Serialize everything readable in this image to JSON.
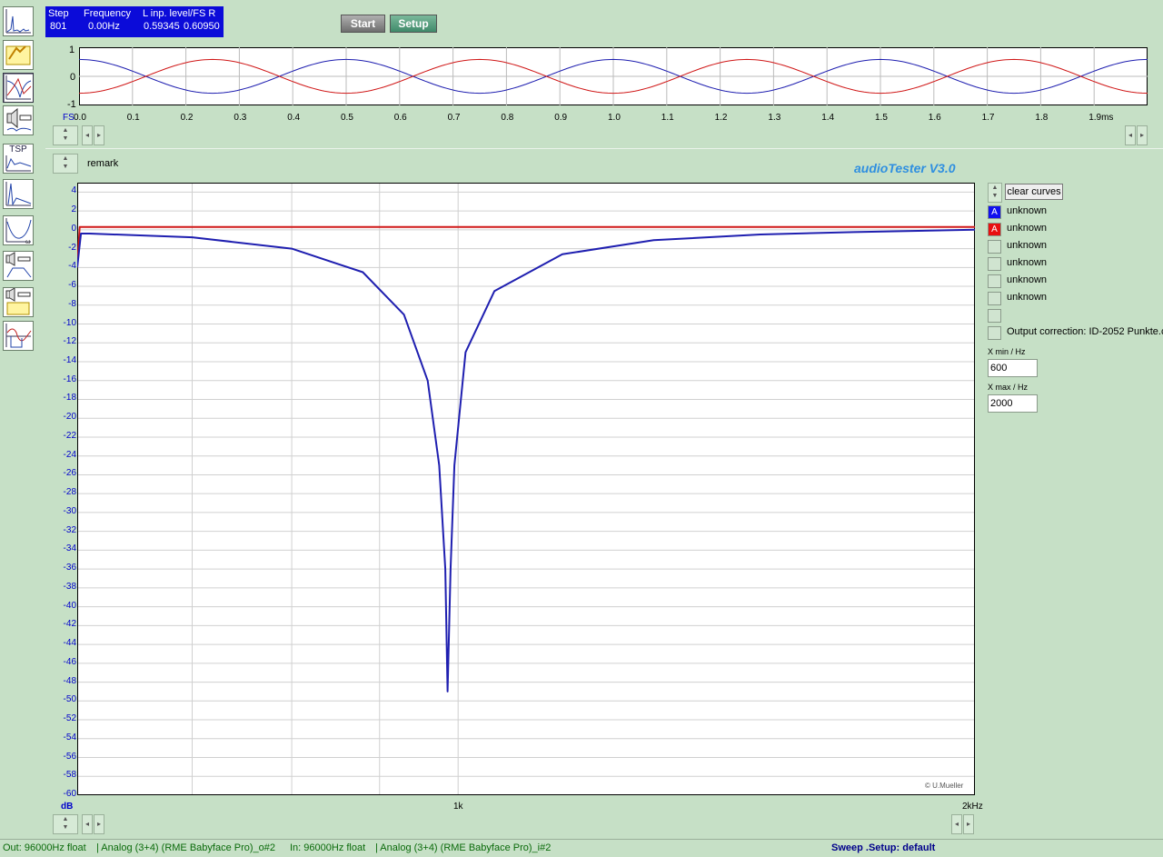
{
  "info": {
    "step_label": "Step",
    "step_value": "801",
    "freq_label": "Frequency",
    "freq_value": "0.00Hz",
    "level_label": "L  inp. level/FS  R",
    "level_left": "0.59345",
    "level_right": "0.60950"
  },
  "toolbar": {
    "start_label": "Start",
    "setup_label": "Setup",
    "tsp_label": "TSP"
  },
  "scope": {
    "y_ticks": [
      "1",
      "0",
      "-1"
    ],
    "x_ticks": [
      "FS",
      "0.0",
      "0.1",
      "0.2",
      "0.3",
      "0.4",
      "0.5",
      "0.6",
      "0.7",
      "0.8",
      "0.9",
      "1.0",
      "1.1",
      "1.2",
      "1.3",
      "1.4",
      "1.5",
      "1.6",
      "1.7",
      "1.8",
      "1.9ms"
    ]
  },
  "remark_label": "remark",
  "app_title": "audioTester  V3.0",
  "plot": {
    "y_unit": "dB",
    "y_ticks": [
      "4",
      "2",
      "0",
      "-2",
      "-4",
      "-6",
      "-8",
      "-10",
      "-12",
      "-14",
      "-16",
      "-18",
      "-20",
      "-22",
      "-24",
      "-26",
      "-28",
      "-30",
      "-32",
      "-34",
      "-36",
      "-38",
      "-40",
      "-42",
      "-44",
      "-46",
      "-48",
      "-50",
      "-52",
      "-54",
      "-56",
      "-58",
      "-60"
    ],
    "x_ticks": [
      "1k",
      "2kHz"
    ],
    "copyright": "© U.Mueller"
  },
  "legend": {
    "clear_label": "clear curves",
    "items": [
      {
        "mark": "A",
        "label": "unknown"
      },
      {
        "mark": "A",
        "label": "unknown"
      },
      {
        "mark": "",
        "label": "unknown"
      },
      {
        "mark": "",
        "label": "unknown"
      },
      {
        "mark": "",
        "label": "unknown"
      },
      {
        "mark": "",
        "label": "unknown"
      },
      {
        "mark": "",
        "label": ""
      },
      {
        "mark": "",
        "label": "Output correction: ID-2052 Punkte.c"
      }
    ],
    "xmin_label": "X min / Hz",
    "xmin_value": "600",
    "xmax_label": "X max / Hz",
    "xmax_value": "2000"
  },
  "status": {
    "out": "Out: 96000Hz float",
    "out_dev": "| Analog (3+4) (RME Babyface Pro)_o#2",
    "in": "In: 96000Hz float",
    "in_dev": "| Analog (3+4) (RME Babyface Pro)_i#2",
    "mode": "Sweep  .Setup:  default"
  },
  "colors": {
    "channel_left": "#1f1fb0",
    "channel_right": "#d01818",
    "background": "#c6e0c6",
    "title": "#2f8fe0"
  },
  "chart_data": {
    "type": "line",
    "xlim": [
      600,
      2000
    ],
    "ylim": [
      -60,
      5
    ],
    "x_scale": "log",
    "grid": true,
    "series": [
      {
        "color": "#d01818",
        "x": [
          600,
          602,
          605,
          700,
          1000,
          1500,
          2000
        ],
        "y": [
          -4,
          0.3,
          0.3,
          0.3,
          0.3,
          0.3,
          0.3
        ]
      },
      {
        "color": "#1f1fb0",
        "x": [
          600,
          603,
          610,
          700,
          800,
          880,
          930,
          960,
          975,
          983,
          986,
          990,
          995,
          1010,
          1050,
          1150,
          1300,
          1500,
          1700,
          2000
        ],
        "y": [
          -4,
          -0.4,
          -0.4,
          -0.8,
          -2.0,
          -4.5,
          -9,
          -16,
          -25,
          -36,
          -49,
          -36,
          -25,
          -13,
          -6.5,
          -2.6,
          -1.1,
          -0.5,
          -0.25,
          0
        ]
      }
    ]
  }
}
